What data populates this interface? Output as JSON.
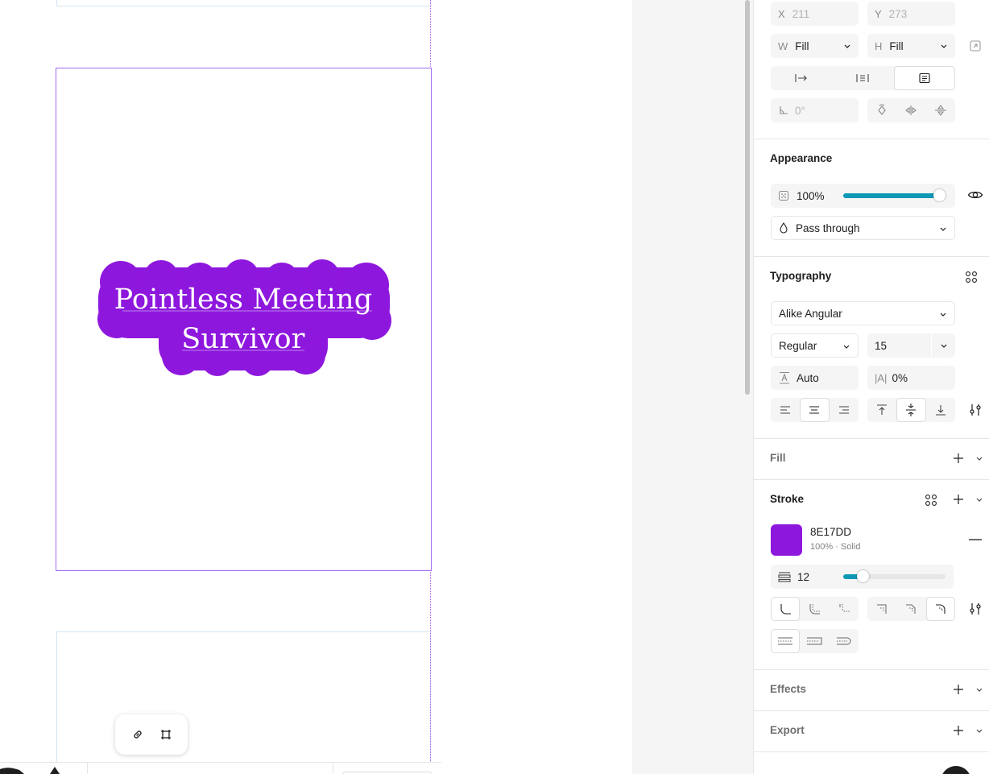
{
  "canvas": {
    "frame_title_line1": "Pointless Meeting",
    "frame_title_line2": "Survivor",
    "sticker_color": "#8E17DD",
    "selection_color": "#A06CF2",
    "floating_toolbar": {
      "link_icon": "link-icon",
      "frame_icon": "frame-icon"
    }
  },
  "panel": {
    "position": {
      "x_label": "X",
      "x_value": "211",
      "y_label": "Y",
      "y_value": "273",
      "w_label": "W",
      "w_value": "Fill",
      "h_label": "H",
      "h_value": "Fill",
      "rotation_value": "0°"
    },
    "appearance": {
      "title": "Appearance",
      "opacity": "100%",
      "opacity_level": 1.0,
      "blend_mode": "Pass through"
    },
    "typography": {
      "title": "Typography",
      "font_family": "Alike Angular",
      "font_style": "Regular",
      "font_size": "15",
      "line_height": "Auto",
      "letter_spacing": "0%"
    },
    "fill": {
      "title": "Fill"
    },
    "stroke": {
      "title": "Stroke",
      "color_hex": "8E17DD",
      "color": "#8E17DD",
      "detail": "100% · Solid",
      "weight": "12",
      "weight_level": 0.19
    },
    "effects": {
      "title": "Effects"
    },
    "export": {
      "title": "Export"
    }
  }
}
